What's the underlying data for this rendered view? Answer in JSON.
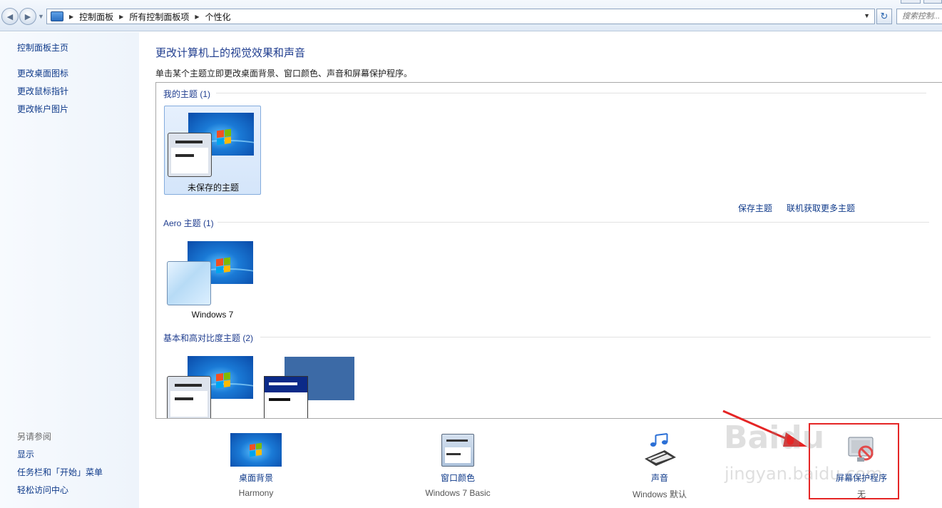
{
  "address_bar": {
    "breadcrumbs": [
      "控制面板",
      "所有控制面板项",
      "个性化"
    ],
    "search_placeholder": "搜索控制..."
  },
  "sidebar": {
    "home_link": "控制面板主页",
    "links": [
      "更改桌面图标",
      "更改鼠标指针",
      "更改帐户图片"
    ],
    "see_also_title": "另请参阅",
    "see_also": [
      "显示",
      "任务栏和「开始」菜单",
      "轻松访问中心"
    ]
  },
  "main": {
    "title": "更改计算机上的视觉效果和声音",
    "description": "单击某个主题立即更改桌面背景、窗口颜色、声音和屏幕保护程序。",
    "groups": {
      "my_themes": {
        "heading": "我的主题 (1)",
        "tiles": [
          "未保存的主题"
        ]
      },
      "aero": {
        "heading": "Aero 主题 (1)",
        "tiles": [
          "Windows 7"
        ]
      },
      "basic": {
        "heading": "基本和高对比度主题 (2)"
      }
    },
    "save_theme": "保存主题",
    "get_more_themes": "联机获取更多主题"
  },
  "settings": {
    "desktop_background": {
      "label": "桌面背景",
      "value": "Harmony"
    },
    "window_color": {
      "label": "窗口颜色",
      "value": "Windows 7 Basic"
    },
    "sounds": {
      "label": "声音",
      "value": "Windows 默认"
    },
    "screen_saver": {
      "label": "屏幕保护程序",
      "value": "无"
    }
  },
  "watermark": {
    "brand": "Baidu",
    "url": "jingyan.baidu.com"
  },
  "colors": {
    "link": "#0f3a8a",
    "title": "#1f3d8f",
    "annotation": "#e52525"
  }
}
